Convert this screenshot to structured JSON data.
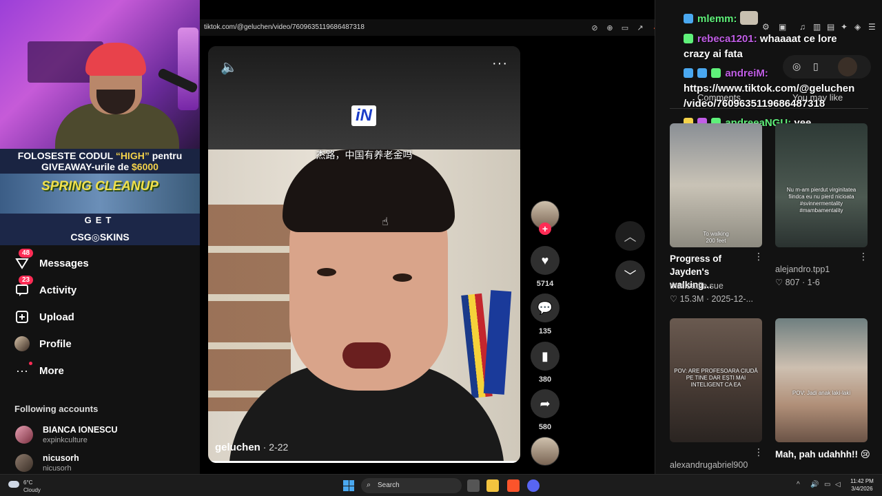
{
  "stream_overlay": {
    "promo_line1_prefix": "FOLOSESTE CODUL ",
    "promo_line1_code": "“HIGH”",
    "promo_line1_suffix": " pentru",
    "promo_line2_prefix": "GIVEAWAY-urile de ",
    "promo_line2_amount": "$6000",
    "spring_cleanup": "SPRING CLEANUP",
    "get": "GET",
    "csg_skins": "CSG◎SKINS"
  },
  "browser": {
    "url": "tiktok.com/@geluchen/video/7609635119686487318"
  },
  "sidebar": {
    "items": [
      {
        "label": "Messages",
        "badge": "48",
        "icon": "paper-plane-icon"
      },
      {
        "label": "Activity",
        "badge": "23",
        "icon": "message-icon"
      },
      {
        "label": "Upload",
        "icon": "plus-square-icon"
      },
      {
        "label": "Profile",
        "icon": "avatar-icon"
      },
      {
        "label": "More",
        "icon": "ellipsis-icon"
      }
    ],
    "following_title": "Following accounts",
    "following": [
      {
        "name": "BIANCA IONESCU",
        "handle": "expinkculture"
      },
      {
        "name": "nicusorh",
        "handle": "nicusorh"
      }
    ]
  },
  "video": {
    "subtitle": "杰路，中国有养老金吗",
    "logo_text": "iN",
    "author": "geluchen",
    "date": " · 2-22",
    "progress_fraction": 0.99,
    "likes": "5714",
    "comments": "135",
    "saves": "380",
    "shares": "580"
  },
  "chat": {
    "lines": [
      {
        "user": "mlemm:",
        "text": "",
        "color": "#5ff07a"
      },
      {
        "user": "rebeca1201:",
        "text": " whaaaat ce lore",
        "color": "#c15ee6"
      },
      {
        "user": "",
        "text": "crazy ai fata",
        "color": "#ffffff"
      },
      {
        "user": "andreiM:",
        "text": "",
        "color": "#c15ee6"
      },
      {
        "user": "",
        "text": "https://www.tiktok.com/@geluchen",
        "color": "#ffffff"
      },
      {
        "user": "",
        "text": "/video/7609635119686487318",
        "color": "#ffffff"
      },
      {
        "user": "andreeaNGU:",
        "text": " yee",
        "color": "#5ff07a"
      }
    ]
  },
  "right_panel": {
    "tabs": [
      "Comments",
      "You may like"
    ],
    "cards": [
      {
        "caption": "To walking\n200 feet",
        "title": "Progress of Jayden's walking...",
        "meta": "♡ 15.3M · 2025-12-..."
      },
      {
        "caption": "Nu m-am pierdut virginitatea fiindca eu nu pierd nicioata #svinnermentality #mambamentality",
        "title": "",
        "author": "alejandro.tpp1",
        "meta": "♡ 807 · 1-6"
      },
      {
        "caption": "POV: ARE PROFESOARA CIUDĂ PE TINE DAR EȘTI MAI INTELIGENT CA EA",
        "title": "",
        "author": "alexandrugabriel900",
        "meta": ""
      },
      {
        "caption": "POV: Jadi anak laki-laki",
        "title": "Mah, pah udahhh!! 😢",
        "meta": ""
      }
    ],
    "card1_author": "that.sadie.sue"
  },
  "taskbar": {
    "temp": "6°C",
    "condition": "Cloudy",
    "search": "Search",
    "time": "11:42 PM",
    "date": "3/4/2026"
  },
  "colors": {
    "accent_pink": "#fe2c55",
    "bg": "#121212"
  }
}
